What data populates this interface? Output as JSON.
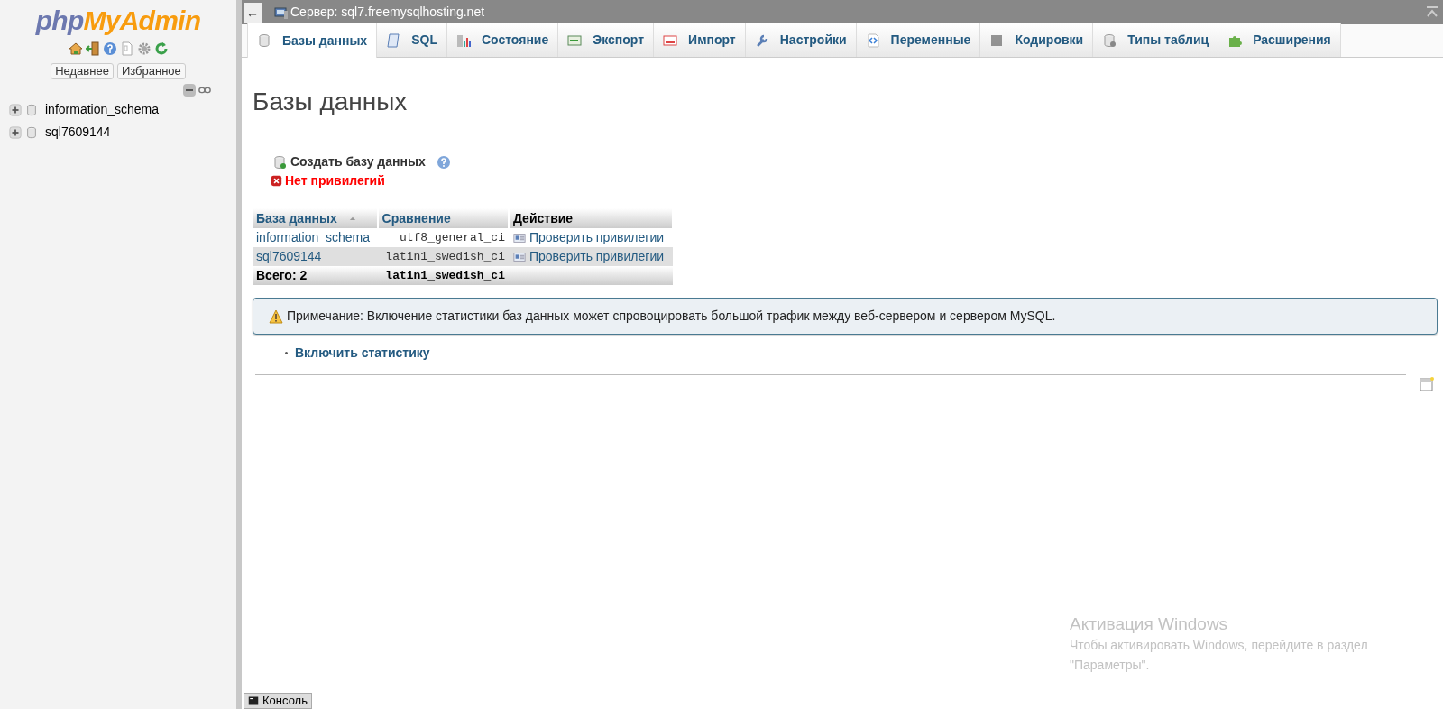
{
  "sidebar": {
    "logo_left": "php",
    "logo_right": "MyAdmin",
    "buttons": [
      {
        "label": "Недавнее"
      },
      {
        "label": "Избранное"
      }
    ],
    "tree": [
      {
        "label": "information_schema",
        "expanded": false
      },
      {
        "label": "sql7609144",
        "expanded": false
      }
    ]
  },
  "top_bar": {
    "back": "←",
    "title": "Сервер: sql7.freemysqlhosting.net"
  },
  "tabs": [
    {
      "label": "Базы данных",
      "selected": true
    },
    {
      "label": "SQL",
      "selected": false
    },
    {
      "label": "Состояние",
      "selected": false
    },
    {
      "label": "Экспорт",
      "selected": false
    },
    {
      "label": "Импорт",
      "selected": false
    },
    {
      "label": "Настройки",
      "selected": false
    },
    {
      "label": "Переменные",
      "selected": false
    },
    {
      "label": "Кодировки",
      "selected": false
    },
    {
      "label": "Типы таблиц",
      "selected": false
    },
    {
      "label": "Расширения",
      "selected": false
    }
  ],
  "page_title": "Базы данных",
  "create_database": "Создать базу данных",
  "error": "Нет привилегий",
  "table": {
    "columns": [
      "База данных",
      "Сравнение",
      "Действие"
    ],
    "rows": [
      {
        "name": "information_schema",
        "collation": "utf8_general_ci",
        "action": "Проверить привилегии"
      },
      {
        "name": "sql7609144",
        "collation": "latin1_swedish_ci",
        "action": "Проверить привилегии"
      }
    ],
    "footer": {
      "label": "Всего: 2",
      "collation": "latin1_swedish_ci"
    }
  },
  "notice": "Примечание: Включение статистики баз данных может спровоцировать большой трафик между веб-сервером и сервером MySQL.",
  "links": [
    "Включить статистику"
  ],
  "console": "Консоль",
  "activation_notice": {
    "title": "Активация Windows",
    "text": "Чтобы активировать Windows, перейдите в раздел \"Параметры\"."
  }
}
